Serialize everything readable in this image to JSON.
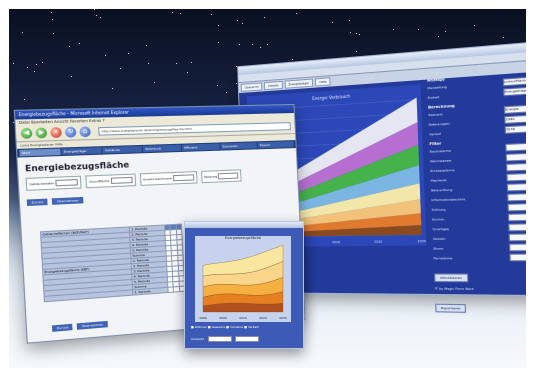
{
  "background": {
    "top": "#0a1020",
    "horizon": "#5e7398",
    "floor": "#f4f8fb"
  },
  "right_window": {
    "tabs": [
      "Übersicht",
      "Details",
      "Energieträger",
      "Hilfe"
    ],
    "chart_title": "Energie Verbrauch",
    "series_colors": [
      "#8b4a1e",
      "#e07a2e",
      "#f3c27a",
      "#f2e6a8",
      "#7bb6e3",
      "#45b24a",
      "#b66fd0",
      "#e6e6f2"
    ],
    "panel": {
      "section1": "Anzeige",
      "fields1": [
        {
          "label": "Darstellung",
          "value": "Linien/Flächen"
        },
        {
          "label": "Einheit",
          "value": "Energieträger"
        }
      ],
      "section2": "Berechnung",
      "fields2": [
        {
          "label": "Szenario",
          "value": "Energie"
        },
        {
          "label": "Referenzjahr",
          "value": "1990"
        },
        {
          "label": "Verlauf",
          "value": "2030"
        }
      ],
      "section3": "Filter",
      "filter_items": [
        "Raumwärme",
        "Warmwasser",
        "Prozesswärme",
        "Mechanik",
        "Beleuchtung",
        "Informationstechnik",
        "Kühlung",
        "Kochen",
        "Sonstiges",
        "Verkehr",
        "Strom",
        "Fernwärme"
      ],
      "button1": "Aktualisieren",
      "note": "© by Magic Form Werk",
      "button2": "Exportieren"
    },
    "axis_years": [
      "1990",
      "2000",
      "2010",
      "2020",
      "2030"
    ]
  },
  "left_window": {
    "title": "Energiebezugsfläche - Microsoft Internet Explorer",
    "menu": "Datei  Bearbeiten  Ansicht  Favoriten  Extras  ?",
    "address": "http://www.energieplaner.de/energiebezugsflaeche.html",
    "links": "Links   Energieplaner   Hilfe",
    "app_tabs": [
      "Start",
      "Energieträger",
      "Gebäude",
      "Verbrauch",
      "Effizienz",
      "Szenarien",
      "Export"
    ],
    "heading": "Energiebezugsfläche",
    "blocks": [
      "Gebäudedaten",
      "Grundfläche",
      "Anzahl Geschosse",
      "Nutzung"
    ],
    "button_a": "Zurück",
    "button_b": "Übernehmen",
    "row_labels": [
      "1. Periode",
      "2. Periode",
      "3. Periode",
      "4. Periode",
      "5. Periode",
      "Summe"
    ],
    "section_labels": [
      "Gebäudeflächen (BGF/NGF)",
      "Energiebezugsfläche (EBF)"
    ],
    "button_c": "Zurück",
    "button_d": "Übernehmen"
  },
  "small_window": {
    "chart_title": "Energiebezugsfläche",
    "colors": [
      "#b0501e",
      "#e67e22",
      "#f5b041",
      "#fbd68a",
      "#f9e79f"
    ],
    "legend": "■ Wohnen  ■ Gewerbe  ■ Industrie  ■ Verkehr",
    "footer": "Auswahl:",
    "years": [
      "1990",
      "2000",
      "2010",
      "2020",
      "2030"
    ]
  }
}
